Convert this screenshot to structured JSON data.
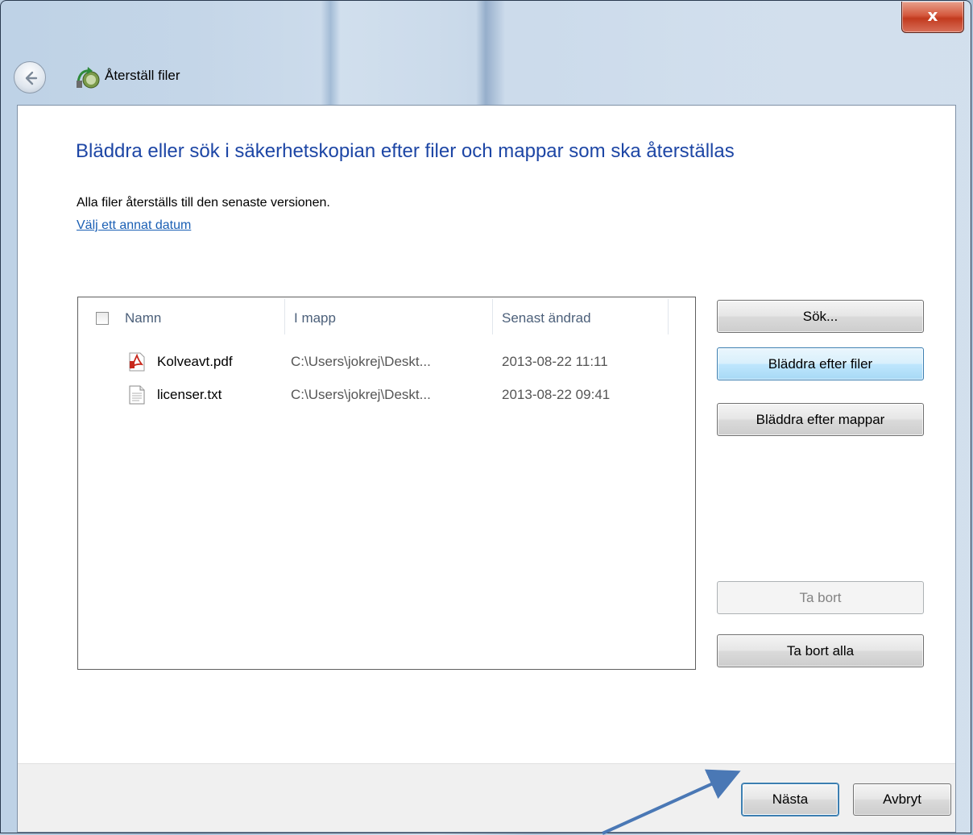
{
  "window": {
    "title": "Återställ filer",
    "close_label": "x"
  },
  "page": {
    "heading": "Bläddra eller sök i säkerhetskopian efter filer och mappar som ska återställas",
    "info_text": "Alla filer återställs till den senaste versionen.",
    "date_link": "Välj ett annat datum"
  },
  "file_list": {
    "columns": [
      "Namn",
      "I mapp",
      "Senast ändrad"
    ],
    "rows": [
      {
        "name": "Kolveavt.pdf",
        "folder": "C:\\Users\\jokrej\\Deskt...",
        "modified": "2013-08-22 11:11",
        "icon": "pdf-file-icon"
      },
      {
        "name": "licenser.txt",
        "folder": "C:\\Users\\jokrej\\Deskt...",
        "modified": "2013-08-22 09:41",
        "icon": "text-file-icon"
      }
    ]
  },
  "side_buttons": {
    "search": "Sök...",
    "browse_files": "Bläddra efter filer",
    "browse_folders": "Bläddra efter mappar",
    "remove": "Ta bort",
    "remove_all": "Ta bort alla"
  },
  "footer": {
    "next": "Nästa",
    "cancel": "Avbryt"
  },
  "colors": {
    "heading": "#1d46a5",
    "link": "#1a5fb4",
    "annotation_arrow": "#4a78b5"
  }
}
